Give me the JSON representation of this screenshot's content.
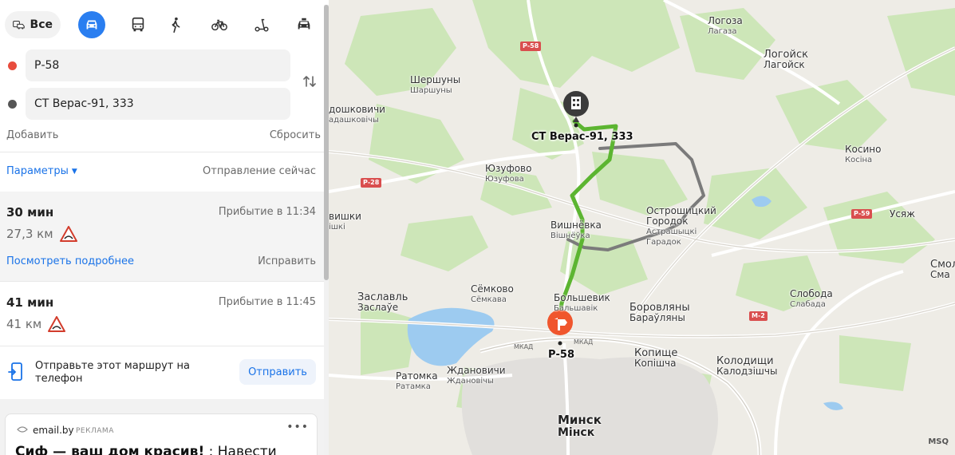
{
  "transport_modes": {
    "all_label": "Все",
    "selected": "car",
    "accent_color": "#2a7ef0"
  },
  "route": {
    "from": "Р-58",
    "to": "СТ Верас-91, 333",
    "from_dot_color": "#e84c3d",
    "to_dot_color": "#555555",
    "add_label": "Добавить",
    "reset_label": "Сбросить",
    "params_label": "Параметры",
    "departure_label": "Отправление сейчас"
  },
  "routes": [
    {
      "duration": "30 мин",
      "distance": "27,3 км",
      "arrival": "Прибытие в 11:34",
      "details": "Посмотреть подробнее",
      "fix": "Исправить"
    },
    {
      "duration": "41 мин",
      "distance": "41 км",
      "arrival": "Прибытие в 11:45"
    }
  ],
  "send": {
    "text": "Отправьте этот маршрут на телефон",
    "button": "Отправить"
  },
  "ad": {
    "source": "email.by",
    "tag": "РЕКЛАМА",
    "title_bold": "Сиф — ваш дом красив!",
    "title_rest": " : Навести"
  },
  "map": {
    "destination_label": "СТ Верас-91, 333",
    "origin_label": "Р-58",
    "route_color": "#5cb531",
    "alt_route_color": "#777777",
    "places": {
      "logoza": {
        "name": "Логоза",
        "sub": "Лагаза"
      },
      "logoisk": {
        "name": "Логойск",
        "sub": "Лагойск"
      },
      "shershuny": {
        "name": "Шершуны",
        "sub": "Шаршуны"
      },
      "dashkovichi": {
        "name": "дошковичи",
        "sub": "адашковічы"
      },
      "yuzufovo": {
        "name": "Юзуфово",
        "sub": "Юзуфова"
      },
      "kosino": {
        "name": "Косино",
        "sub": "Косіна"
      },
      "ostroshitsky": {
        "name": "Острошицкий",
        "name2": "Городок",
        "sub": "Астрашыцкі",
        "sub2": "Гарадок"
      },
      "vishnevka": {
        "name": "Вишнёвка",
        "sub": "Вішнёўка"
      },
      "ushkevichi": {
        "name": "вишки",
        "sub": "ішкі"
      },
      "usyazh": {
        "name": "Усяж"
      },
      "smol": {
        "name": "Смол",
        "sub": "Сма"
      },
      "sloboda": {
        "name": "Слобода",
        "sub": "Слабада"
      },
      "zaslavl": {
        "name": "Заславль",
        "sub": "Заслаўе"
      },
      "semkovo": {
        "name": "Сёмково",
        "sub": "Сёмкава"
      },
      "bolshevik": {
        "name": "Большевик",
        "sub": "Бальшавік"
      },
      "borovlyany": {
        "name": "Боровляны",
        "sub": "Бараўляны"
      },
      "kopishche": {
        "name": "Копище",
        "sub": "Копішча"
      },
      "kolodishchi": {
        "name": "Колодищи",
        "sub": "Калодзішчы"
      },
      "ratomka": {
        "name": "Ратомка",
        "sub": "Ратамка"
      },
      "zhdanovichi": {
        "name": "Ждановичи",
        "sub": "Ждановічы"
      },
      "minsk": {
        "name": "Минск",
        "sub": "Мінск"
      }
    },
    "road_shields": [
      "Р-58",
      "Р-28",
      "Р-59",
      "М-2"
    ],
    "ring_road_label": "МКАД",
    "attribution": "MSQ"
  }
}
